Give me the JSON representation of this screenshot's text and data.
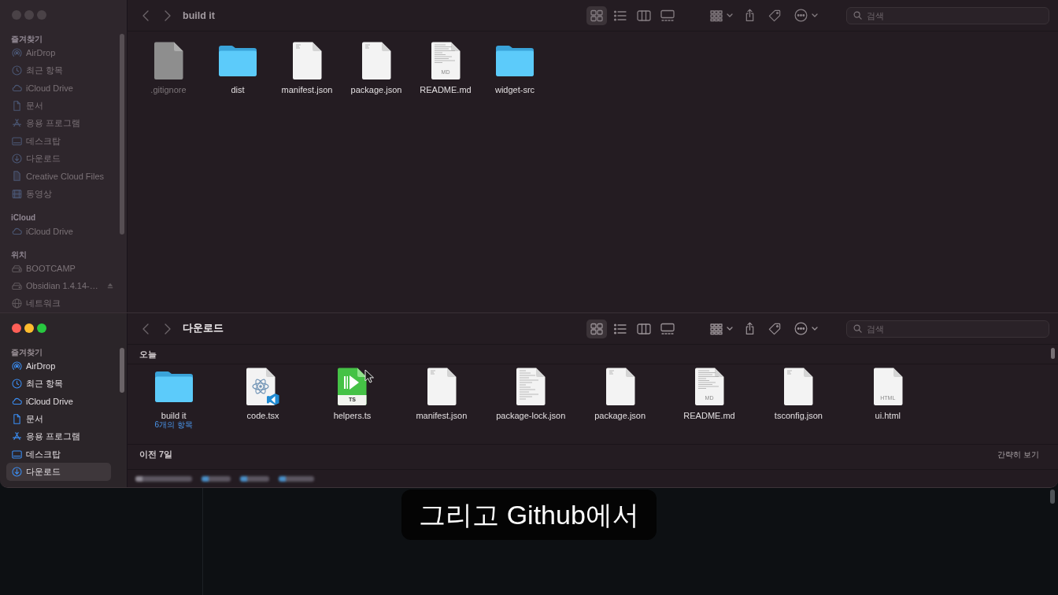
{
  "windows": [
    {
      "active": false,
      "title": "build it",
      "sidebar": [
        {
          "heading": "즐겨찾기",
          "items": [
            {
              "label": "AirDrop",
              "kind": "airdrop",
              "selected": false
            },
            {
              "label": "최근 항목",
              "kind": "recent",
              "selected": false
            },
            {
              "label": "iCloud Drive",
              "kind": "cloud",
              "selected": false
            },
            {
              "label": "문서",
              "kind": "document",
              "selected": false
            },
            {
              "label": "응용 프로그램",
              "kind": "apps",
              "selected": false
            },
            {
              "label": "데스크탑",
              "kind": "desktop",
              "selected": false
            },
            {
              "label": "다운로드",
              "kind": "download",
              "selected": false
            },
            {
              "label": "Creative Cloud Files",
              "kind": "file",
              "selected": false
            },
            {
              "label": "동영상",
              "kind": "movies",
              "selected": false
            }
          ]
        },
        {
          "heading": "iCloud",
          "items": [
            {
              "label": "iCloud Drive",
              "kind": "cloud",
              "selected": false
            }
          ]
        },
        {
          "heading": "위치",
          "items": [
            {
              "label": "BOOTCAMP",
              "kind": "drive",
              "selected": false
            },
            {
              "label": "Obsidian 1.4.14-…",
              "kind": "external",
              "selected": false
            },
            {
              "label": "네트워크",
              "kind": "network",
              "selected": false
            }
          ]
        }
      ],
      "views": [
        {
          "kind": "grid",
          "selected": true
        },
        {
          "kind": "list",
          "selected": false
        },
        {
          "kind": "columns",
          "selected": false
        },
        {
          "kind": "gallery",
          "selected": false
        }
      ],
      "search": {
        "placeholder": "검색"
      },
      "groups": [
        {
          "items": [
            {
              "name": ".gitignore",
              "kind": "generic",
              "dimmed": true
            },
            {
              "name": "dist",
              "kind": "folder",
              "dimmed": false
            },
            {
              "name": "manifest.json",
              "kind": "document",
              "dimmed": false
            },
            {
              "name": "package.json",
              "kind": "document",
              "dimmed": false
            },
            {
              "name": "README.md",
              "kind": "markdown",
              "badge": "MD",
              "dimmed": false
            },
            {
              "name": "widget-src",
              "kind": "folder",
              "dimmed": false
            }
          ]
        }
      ]
    },
    {
      "active": true,
      "title": "다운로드",
      "sidebar": [
        {
          "heading": "즐겨찾기",
          "items": [
            {
              "label": "AirDrop",
              "kind": "airdrop",
              "selected": false
            },
            {
              "label": "최근 항목",
              "kind": "recent",
              "selected": false
            },
            {
              "label": "iCloud Drive",
              "kind": "cloud",
              "selected": false
            },
            {
              "label": "문서",
              "kind": "document",
              "selected": false
            },
            {
              "label": "응용 프로그램",
              "kind": "apps",
              "selected": false
            },
            {
              "label": "데스크탑",
              "kind": "desktop",
              "selected": false
            },
            {
              "label": "다운로드",
              "kind": "download",
              "selected": true
            }
          ]
        }
      ],
      "views": [
        {
          "kind": "grid",
          "selected": true
        },
        {
          "kind": "list",
          "selected": false
        },
        {
          "kind": "columns",
          "selected": false
        },
        {
          "kind": "gallery",
          "selected": false
        }
      ],
      "search": {
        "placeholder": "검색"
      },
      "groups": [
        {
          "heading": "오늘",
          "items": [
            {
              "name": "build it",
              "kind": "folder",
              "subtitle": "6개의 항목"
            },
            {
              "name": "code.tsx",
              "kind": "react"
            },
            {
              "name": "helpers.ts",
              "kind": "typescript",
              "badge": "TS"
            },
            {
              "name": "manifest.json",
              "kind": "document"
            },
            {
              "name": "package-lock.json",
              "kind": "lined"
            },
            {
              "name": "package.json",
              "kind": "document"
            },
            {
              "name": "README.md",
              "kind": "markdown",
              "badge": "MD"
            },
            {
              "name": "tsconfig.json",
              "kind": "document"
            },
            {
              "name": "ui.html",
              "kind": "html",
              "badge": "HTML"
            }
          ]
        },
        {
          "heading": "이전 7일",
          "action": "간략히 보기"
        }
      ],
      "path_bar": true
    }
  ],
  "caption": "그리고 Github에서"
}
